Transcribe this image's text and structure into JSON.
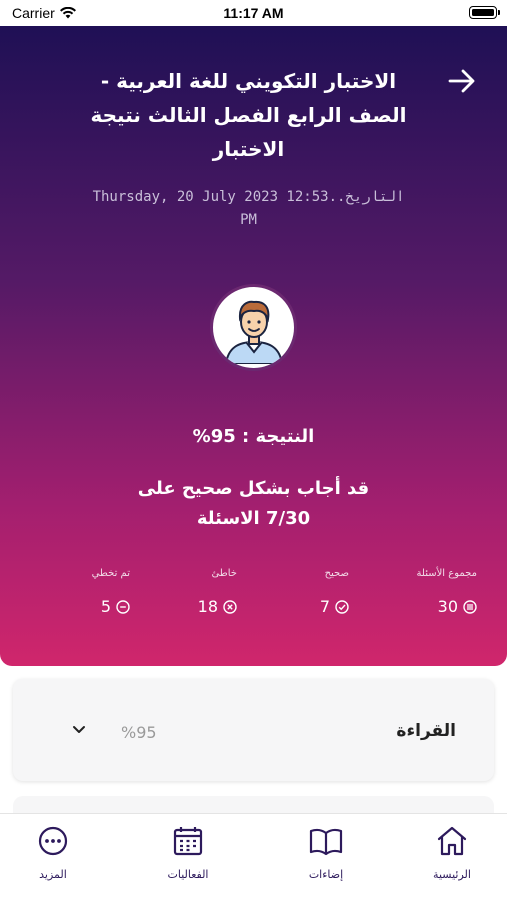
{
  "status_bar": {
    "carrier": "Carrier",
    "time": "11:17 AM"
  },
  "header": {
    "title": "الاختبار التكويني للغة العربية - الصف الرابع الفصل الثالث نتيجة الاختبار",
    "date": "التاريخ..Thursday, 20 July 2023 12:53 PM"
  },
  "result": {
    "score": "النتيجة : 95%",
    "answered": "قد أجاب بشكل صحيح على 7/30 الاسئلة"
  },
  "stats": [
    {
      "label": "مجموع الأسئلة",
      "value": "30",
      "icon": "list-icon"
    },
    {
      "label": "صحيح",
      "value": "7",
      "icon": "check-circle-icon"
    },
    {
      "label": "خاطئ",
      "value": "18",
      "icon": "x-circle-icon"
    },
    {
      "label": "تم تخطي",
      "value": "5",
      "icon": "minus-circle-icon"
    }
  ],
  "section": {
    "subject": "القراءة",
    "percent": "%95"
  },
  "tabs": [
    {
      "label": "الرئيسية",
      "icon": "home-icon"
    },
    {
      "label": "إضاءات",
      "icon": "book-icon"
    },
    {
      "label": "الفعاليات",
      "icon": "calendar-icon"
    },
    {
      "label": "المزيد",
      "icon": "more-icon"
    }
  ],
  "colors": {
    "gradient_top": "#1f1055",
    "gradient_bottom": "#d0266c",
    "nav": "#2d1a5c"
  }
}
